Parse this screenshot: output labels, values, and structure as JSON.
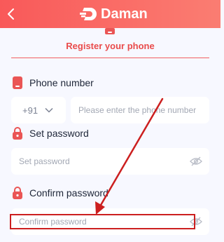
{
  "header": {
    "logo_text": "Daman",
    "back_icon": "chevron-left-icon",
    "logo_icon": "brand-d-logo-icon"
  },
  "register_tab": {
    "label": "Register your phone",
    "icon": "phone-icon"
  },
  "phone_section": {
    "label": "Phone number",
    "icon": "phone-icon",
    "country_code": "+91",
    "placeholder": "Please enter the phone number"
  },
  "set_password": {
    "label": "Set password",
    "icon": "lock-icon",
    "placeholder": "Set password",
    "toggle_icon": "eye-off-icon"
  },
  "confirm_password": {
    "label": "Confirm password",
    "icon": "lock-icon",
    "placeholder": "Confirm password",
    "toggle_icon": "eye-off-icon"
  },
  "colors": {
    "header_gradient_start": "#f95959",
    "header_gradient_end": "#fa7d72",
    "accent": "#e94b4b",
    "annotation": "#cc1f1f",
    "background": "#f7f8ff"
  }
}
